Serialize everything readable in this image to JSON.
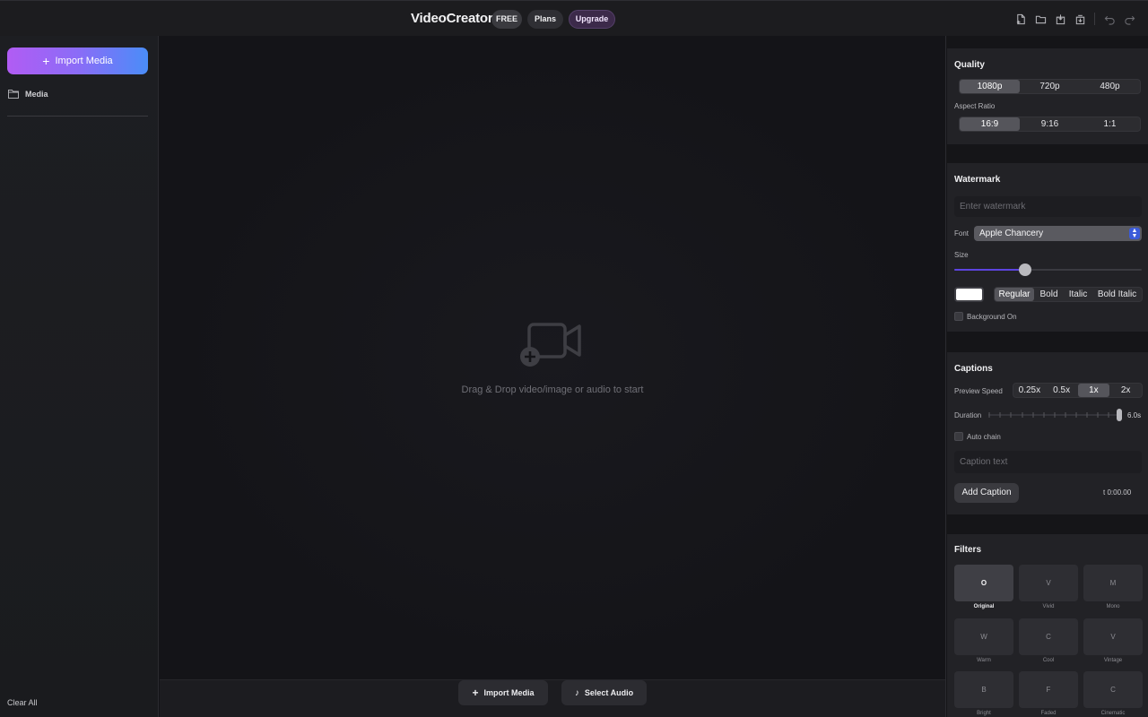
{
  "app": {
    "title": "VideoCreator",
    "badges": {
      "free": "FREE",
      "plans": "Plans",
      "upgrade": "Upgrade"
    },
    "toolbar_icons": [
      "new-project-icon",
      "open-folder-icon",
      "save-icon",
      "export-icon",
      "undo-icon",
      "redo-icon"
    ]
  },
  "sidebar": {
    "import_label": "Import Media",
    "media_label": "Media",
    "clear_all": "Clear All"
  },
  "canvas": {
    "drop_hint": "Drag & Drop video/image or audio to start",
    "bottom": {
      "import_label": "Import Media",
      "audio_label": "Select Audio"
    }
  },
  "quality": {
    "title": "Quality",
    "options": [
      "1080p",
      "720p",
      "480p"
    ],
    "selected": "1080p",
    "aspect_label": "Aspect Ratio",
    "aspect_options": [
      "16:9",
      "9:16",
      "1:1"
    ],
    "aspect_selected": "16:9"
  },
  "watermark": {
    "title": "Watermark",
    "placeholder": "Enter watermark",
    "font_label": "Font",
    "font_value": "Apple Chancery",
    "size_label": "Size",
    "size_level": 0.38,
    "color": "#ffffff",
    "styles": [
      "Regular",
      "Bold",
      "Italic",
      "Bold Italic"
    ],
    "style_selected": "Regular",
    "background_label": "Background On",
    "background_on": false
  },
  "captions": {
    "title": "Captions",
    "speed_label": "Preview Speed",
    "speeds": [
      "0.25x",
      "0.5x",
      "1x",
      "2x"
    ],
    "speed_selected": "1x",
    "duration_label": "Duration",
    "duration_value": "6.0s",
    "auto_chain_label": "Auto chain",
    "caption_placeholder": "Caption text",
    "add_label": "Add Caption",
    "timecode": "t 0:00.00"
  },
  "filters": {
    "title": "Filters",
    "items": [
      {
        "letter": "O",
        "name": "Original",
        "selected": true
      },
      {
        "letter": "V",
        "name": "Vivid"
      },
      {
        "letter": "M",
        "name": "Mono"
      },
      {
        "letter": "W",
        "name": "Warm"
      },
      {
        "letter": "C",
        "name": "Cool"
      },
      {
        "letter": "V",
        "name": "Vintage"
      },
      {
        "letter": "B",
        "name": "Bright"
      },
      {
        "letter": "F",
        "name": "Faded"
      },
      {
        "letter": "C",
        "name": "Cinematic"
      }
    ]
  },
  "colors": {
    "accent_start": "#b15cf4",
    "accent_end": "#4a8df8",
    "slider_fill": "#5d44e0"
  }
}
